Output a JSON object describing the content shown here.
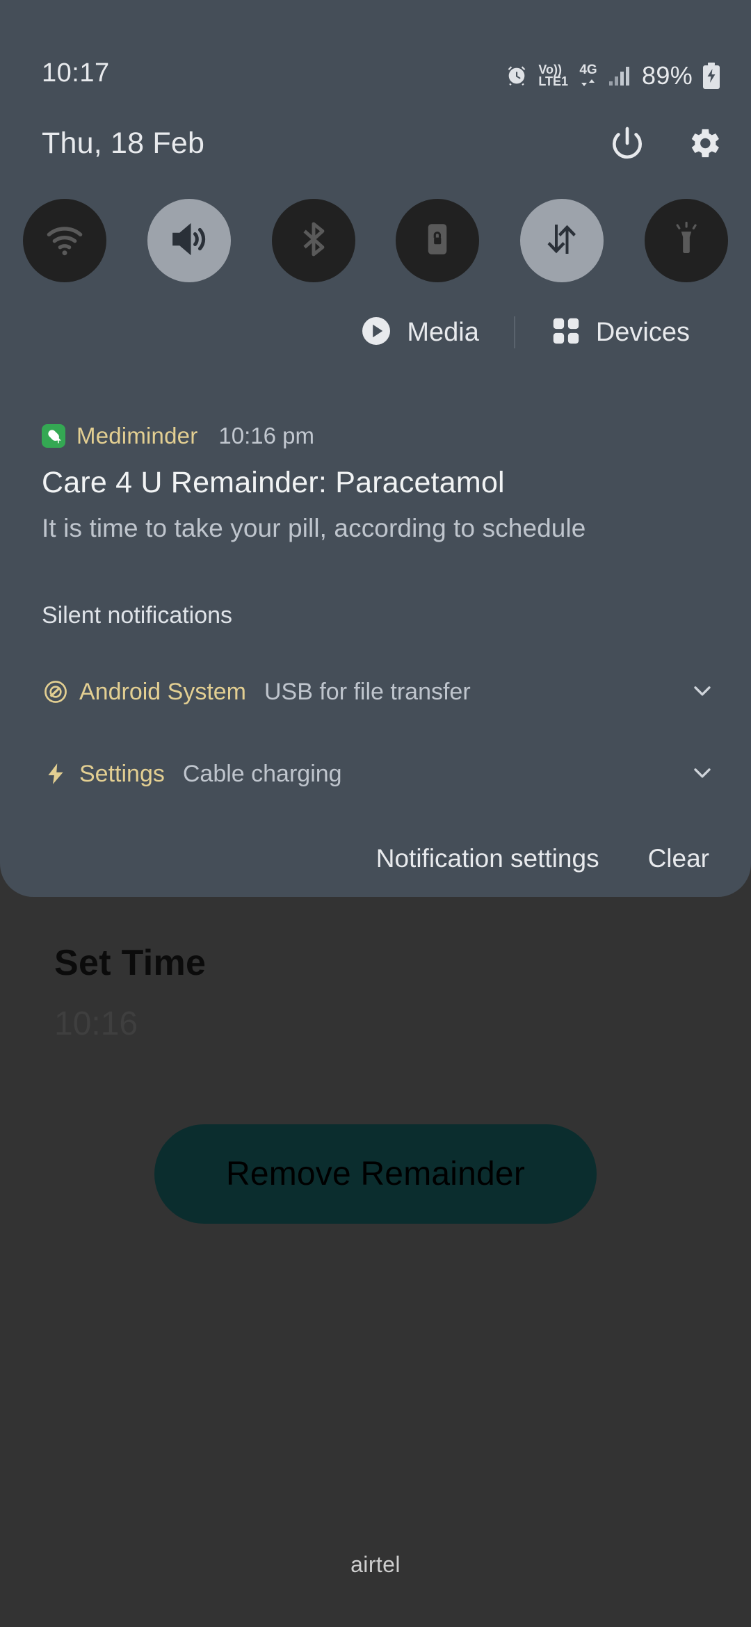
{
  "status_bar": {
    "clock": "10:17",
    "battery_percent": "89%",
    "volte_top": "Vo))",
    "volte_bottom": "LTE1",
    "network_type": "4G",
    "icons": [
      "alarm-icon",
      "volte-icon",
      "mobile-data-arrows-icon",
      "signal-bars-icon",
      "battery-charging-icon"
    ]
  },
  "shade_header": {
    "date": "Thu, 18 Feb",
    "power_label": "power-icon",
    "settings_label": "settings-gear-icon"
  },
  "quick_settings": {
    "tiles": [
      {
        "name": "wifi",
        "icon": "wifi-icon",
        "state": "off"
      },
      {
        "name": "sound",
        "icon": "sound-icon",
        "state": "on"
      },
      {
        "name": "bluetooth",
        "icon": "bluetooth-icon",
        "state": "off"
      },
      {
        "name": "auto-rotate",
        "icon": "rotation-lock-icon",
        "state": "off"
      },
      {
        "name": "mobile-data",
        "icon": "mobile-data-icon",
        "state": "on"
      },
      {
        "name": "flashlight",
        "icon": "flashlight-icon",
        "state": "off"
      }
    ]
  },
  "chips": {
    "media": {
      "label": "Media",
      "icon": "play-circle-icon"
    },
    "devices": {
      "label": "Devices",
      "icon": "devices-grid-icon"
    }
  },
  "notification": {
    "app_name": "Mediminder",
    "app_icon": "pill-icon",
    "time": "10:16 pm",
    "title": "Care 4 U Remainder: Paracetamol",
    "body": "It is time to take your pill, according to schedule"
  },
  "silent_section": {
    "header": "Silent notifications",
    "items": [
      {
        "app": "Android System",
        "text": "USB for file transfer",
        "icon": "android-system-icon",
        "expand": "chevron-down-icon"
      },
      {
        "app": "Settings",
        "text": "Cable charging",
        "icon": "bolt-icon",
        "expand": "chevron-down-icon"
      }
    ]
  },
  "shade_footer": {
    "notification_settings": "Notification settings",
    "clear": "Clear"
  },
  "app_behind": {
    "title": "Set Time",
    "time_value": "10:16",
    "remove_button": "Remove Remainder",
    "carrier": "airtel"
  },
  "colors": {
    "shade_bg": "#454E58",
    "app_bg": "#333333",
    "tile_on": "#9DA3AB",
    "tile_off": "#212121",
    "accent_gold": "#e3cf92",
    "app_icon_green": "#34A853",
    "button_teal": "#0b2d2e"
  }
}
